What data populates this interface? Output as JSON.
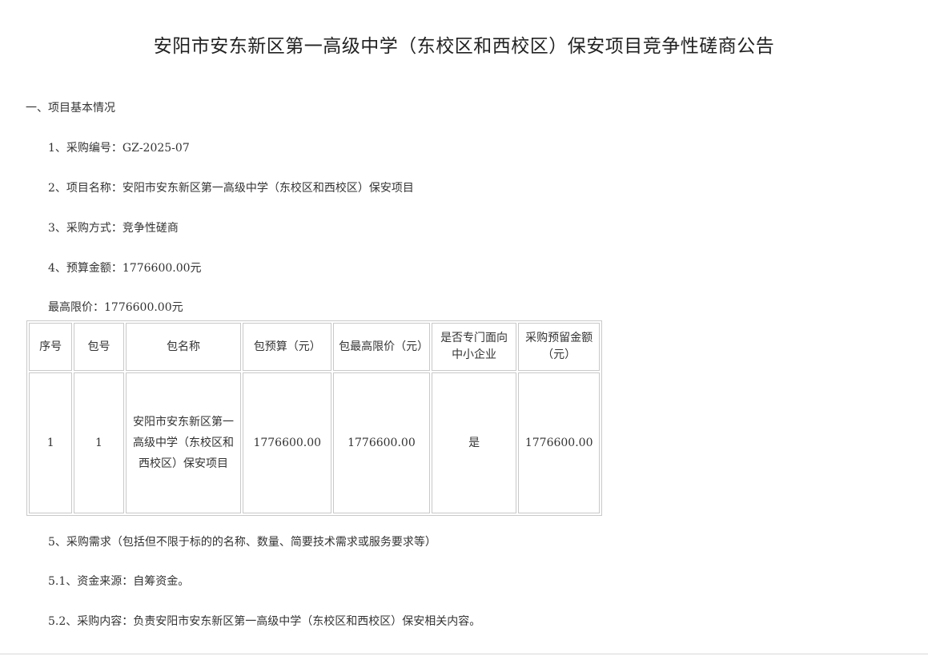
{
  "title": "安阳市安东新区第一高级中学（东校区和西校区）保安项目竞争性磋商公告",
  "section1": "一、项目基本情况",
  "item1": "1、采购编号：GZ-2025-07",
  "item2": "2、项目名称：安阳市安东新区第一高级中学（东校区和西校区）保安项目",
  "item3": "3、采购方式：竞争性磋商",
  "item4": "4、预算金额：1776600.00元",
  "max_price": "最高限价：1776600.00元",
  "table": {
    "headers": [
      "序号",
      "包号",
      "包名称",
      "包预算（元）",
      "包最高限价（元）",
      "是否专门面向中小企业",
      "采购预留金额（元）"
    ],
    "rows": [
      [
        "1",
        "1",
        "安阳市安东新区第一高级中学（东校区和西校区）保安项目",
        "1776600.00",
        "1776600.00",
        "是",
        "1776600.00"
      ]
    ]
  },
  "item5": "5、采购需求（包括但不限于标的的名称、数量、简要技术需求或服务要求等）",
  "item5_1": "5.1、资金来源：自筹资金。",
  "item5_2": "5.2、采购内容：负责安阳市安东新区第一高级中学（东校区和西校区）保安相关内容。"
}
